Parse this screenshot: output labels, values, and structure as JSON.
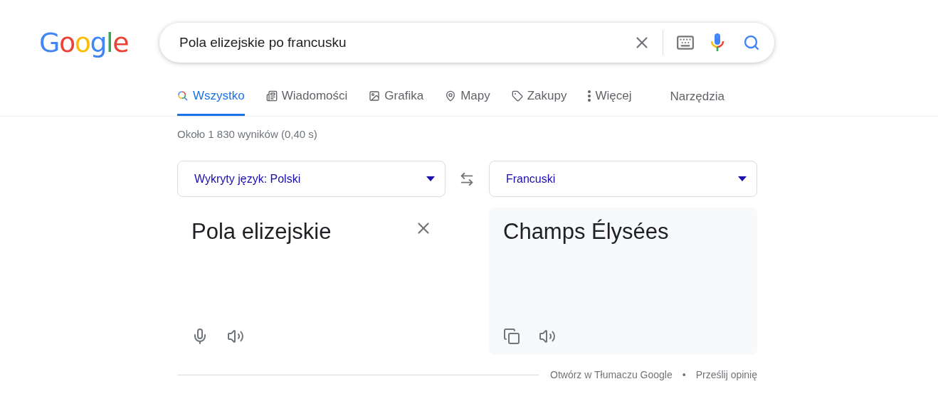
{
  "logo": "Google",
  "search": {
    "value": "Pola elizejskie po francusku"
  },
  "tabs": [
    {
      "label": "Wszystko",
      "kind": "all",
      "selected": true
    },
    {
      "label": "Wiadomości",
      "kind": "news",
      "selected": false
    },
    {
      "label": "Grafika",
      "kind": "images",
      "selected": false
    },
    {
      "label": "Mapy",
      "kind": "maps",
      "selected": false
    },
    {
      "label": "Zakupy",
      "kind": "shopping",
      "selected": false
    },
    {
      "label": "Więcej",
      "kind": "more",
      "selected": false
    }
  ],
  "tools": "Narzędzia",
  "result_stats": "Około 1 830 wyników (0,40 s)",
  "translator": {
    "source_language": {
      "prefix": "Wykryty język: ",
      "name": "Polski"
    },
    "target_language": "Francuski",
    "source_text": "Pola elizejskie",
    "translation": "Champs Élysées"
  },
  "footer": {
    "links": [
      "Otwórz w Tłumaczu Google",
      "Prześlij opinię"
    ],
    "separator": "•"
  }
}
